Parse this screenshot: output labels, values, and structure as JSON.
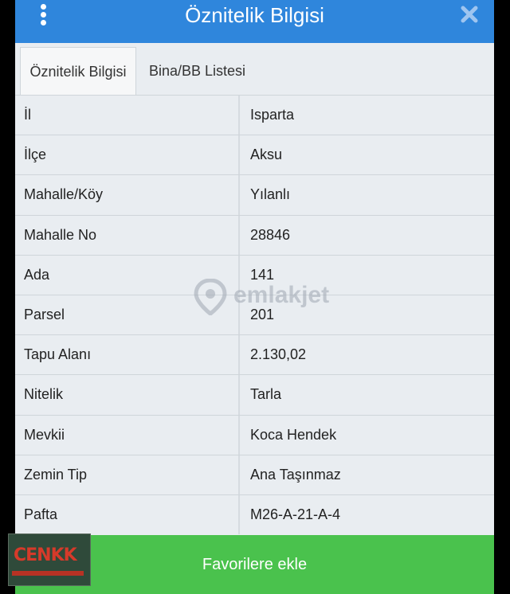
{
  "header": {
    "title": "Öznitelik Bilgisi",
    "menu_icon": "kebab-menu-icon",
    "close_icon": "close-icon",
    "color": "#2f86dc"
  },
  "tabs": [
    {
      "label": "Öznitelik Bilgisi",
      "active": true
    },
    {
      "label": "Bina/BB Listesi",
      "active": false
    }
  ],
  "rows": [
    {
      "key": "İl",
      "value": "Isparta"
    },
    {
      "key": "İlçe",
      "value": "Aksu"
    },
    {
      "key": "Mahalle/Köy",
      "value": "Yılanlı"
    },
    {
      "key": "Mahalle No",
      "value": "28846"
    },
    {
      "key": "Ada",
      "value": "141"
    },
    {
      "key": "Parsel",
      "value": "201"
    },
    {
      "key": "Tapu Alanı",
      "value": "2.130,02"
    },
    {
      "key": "Nitelik",
      "value": "Tarla"
    },
    {
      "key": "Mevkii",
      "value": "Koca Hendek"
    },
    {
      "key": "Zemin Tip",
      "value": "Ana Taşınmaz"
    },
    {
      "key": "Pafta",
      "value": "M26-A-21-A-4"
    }
  ],
  "footer": {
    "button_label": "Favorilere ekle",
    "color": "#4ac24d"
  },
  "watermark": {
    "text": "emlakjet",
    "icon": "location-pin-icon"
  },
  "corner_logo": {
    "text": "CENKK"
  }
}
